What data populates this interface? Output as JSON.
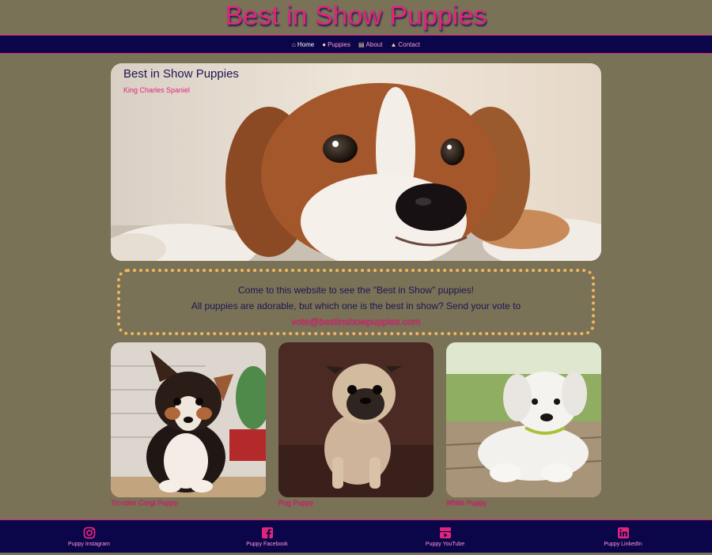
{
  "site": {
    "title": "Best in Show Puppies"
  },
  "nav": {
    "items": [
      {
        "label": "Home",
        "icon": "home-icon"
      },
      {
        "label": "Puppies",
        "icon": "paw-icon"
      },
      {
        "label": "About",
        "icon": "id-card-icon"
      },
      {
        "label": "Contact",
        "icon": "mailbox-icon"
      }
    ]
  },
  "hero": {
    "title": "Best in Show Puppies",
    "subtitle": "King Charles Spaniel"
  },
  "message": {
    "line1": "Come to this website to see the \"Best in Show\" puppies!",
    "line2": "All puppies are adorable, but which one is the best in show? Send your vote to",
    "email": "vote@bestinshowpuppies.com"
  },
  "gallery": [
    {
      "caption": "Tri-color Corgi Puppy"
    },
    {
      "caption": "Pug Puppy"
    },
    {
      "caption": "White Puppy"
    }
  ],
  "footer": {
    "links": [
      {
        "label": "Puppy Instagram",
        "icon": "instagram-icon"
      },
      {
        "label": "Puppy Facebook",
        "icon": "facebook-icon"
      },
      {
        "label": "Puppy YouTube",
        "icon": "youtube-icon"
      },
      {
        "label": "Puppy LinkedIn",
        "icon": "linkedin-icon"
      }
    ]
  },
  "colors": {
    "background": "#7a7257",
    "navy": "#0b054a",
    "pink": "#e0267a",
    "dotted_border": "#f2b65e"
  }
}
